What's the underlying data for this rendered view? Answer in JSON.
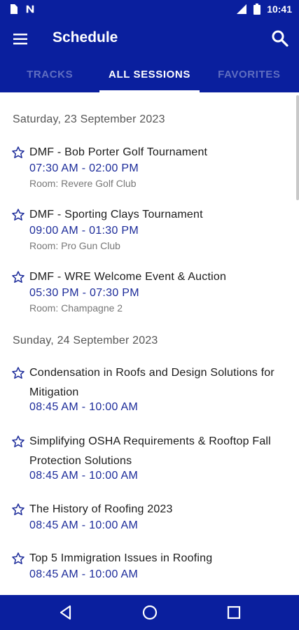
{
  "status_bar": {
    "time": "10:41",
    "icons": [
      "sim-card-icon",
      "n-notification-icon",
      "signal-icon",
      "battery-icon"
    ]
  },
  "app_bar": {
    "title": "Schedule",
    "menu_icon": "menu-icon",
    "search_icon": "search-icon"
  },
  "tabs": [
    {
      "label": "TRACKS",
      "active": false
    },
    {
      "label": "ALL SESSIONS",
      "active": true
    },
    {
      "label": "FAVORITES",
      "active": false
    }
  ],
  "days": [
    {
      "header": "Saturday, 23 September 2023",
      "sessions": [
        {
          "title": "DMF - Bob Porter Golf Tournament",
          "time": "07:30 AM - 02:00 PM",
          "room": "Room: Revere Golf Club"
        },
        {
          "title": "DMF -  Sporting Clays Tournament",
          "time": "09:00 AM - 01:30 PM",
          "room": "Room: Pro Gun Club"
        },
        {
          "title": "DMF - WRE Welcome Event & Auction",
          "time": "05:30 PM - 07:30 PM",
          "room": "Room: Champagne 2"
        }
      ]
    },
    {
      "header": "Sunday, 24 September 2023",
      "sessions": [
        {
          "title": "Condensation in Roofs and Design Solutions for Mitigation",
          "time": "08:45 AM - 10:00 AM"
        },
        {
          "title": "Simplifying OSHA Requirements & Rooftop Fall Protection Solutions",
          "time": "08:45 AM - 10:00 AM"
        },
        {
          "title": "The History of Roofing 2023",
          "time": "08:45 AM - 10:00 AM"
        },
        {
          "title": "Top 5 Immigration Issues in Roofing",
          "time": "08:45 AM - 10:00 AM"
        }
      ]
    }
  ],
  "colors": {
    "primary": "#0a1f9e",
    "time_text": "#1c2b9a",
    "room_text": "#777777",
    "header_text": "#555555"
  },
  "nav_bar": {
    "icons": [
      "back-icon",
      "home-icon",
      "recents-icon"
    ]
  }
}
